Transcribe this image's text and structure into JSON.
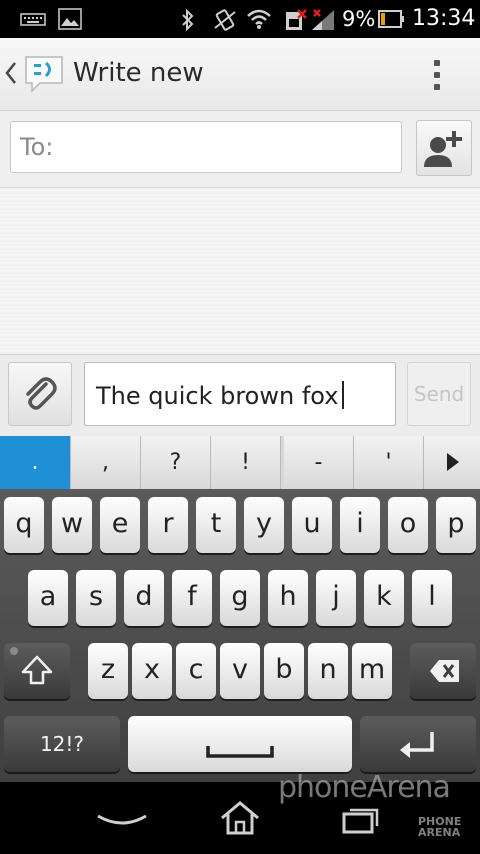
{
  "status_bar": {
    "battery_percent": "9%",
    "time": "13:34",
    "icons": [
      "keyboard-icon",
      "image-icon",
      "bluetooth-icon",
      "vibrate-icon",
      "wifi-icon",
      "sim-error-icon",
      "signal-icon",
      "battery-icon"
    ]
  },
  "action_bar": {
    "title": "Write new",
    "icons": [
      "back-chevron-icon",
      "messaging-app-icon",
      "overflow-menu-icon"
    ]
  },
  "recipients": {
    "to_placeholder": "To:"
  },
  "compose": {
    "message_text": "The quick brown fox",
    "send_label": "Send"
  },
  "suggestions": [
    ".",
    ",",
    "?",
    "!",
    "-",
    "'"
  ],
  "keyboard": {
    "row1": [
      "q",
      "w",
      "e",
      "r",
      "t",
      "y",
      "u",
      "i",
      "o",
      "p"
    ],
    "row2": [
      "a",
      "s",
      "d",
      "f",
      "g",
      "h",
      "j",
      "k",
      "l"
    ],
    "row3": [
      "z",
      "x",
      "c",
      "v",
      "b",
      "n",
      "m"
    ],
    "symbols_label": "12!?"
  },
  "watermark": {
    "brand": "phoneArena",
    "brand_small": "PHONE ARENA"
  },
  "colors": {
    "accent": "#1f8fd6",
    "action_bar": "#efefef",
    "keyboard_bg": "#474747"
  }
}
